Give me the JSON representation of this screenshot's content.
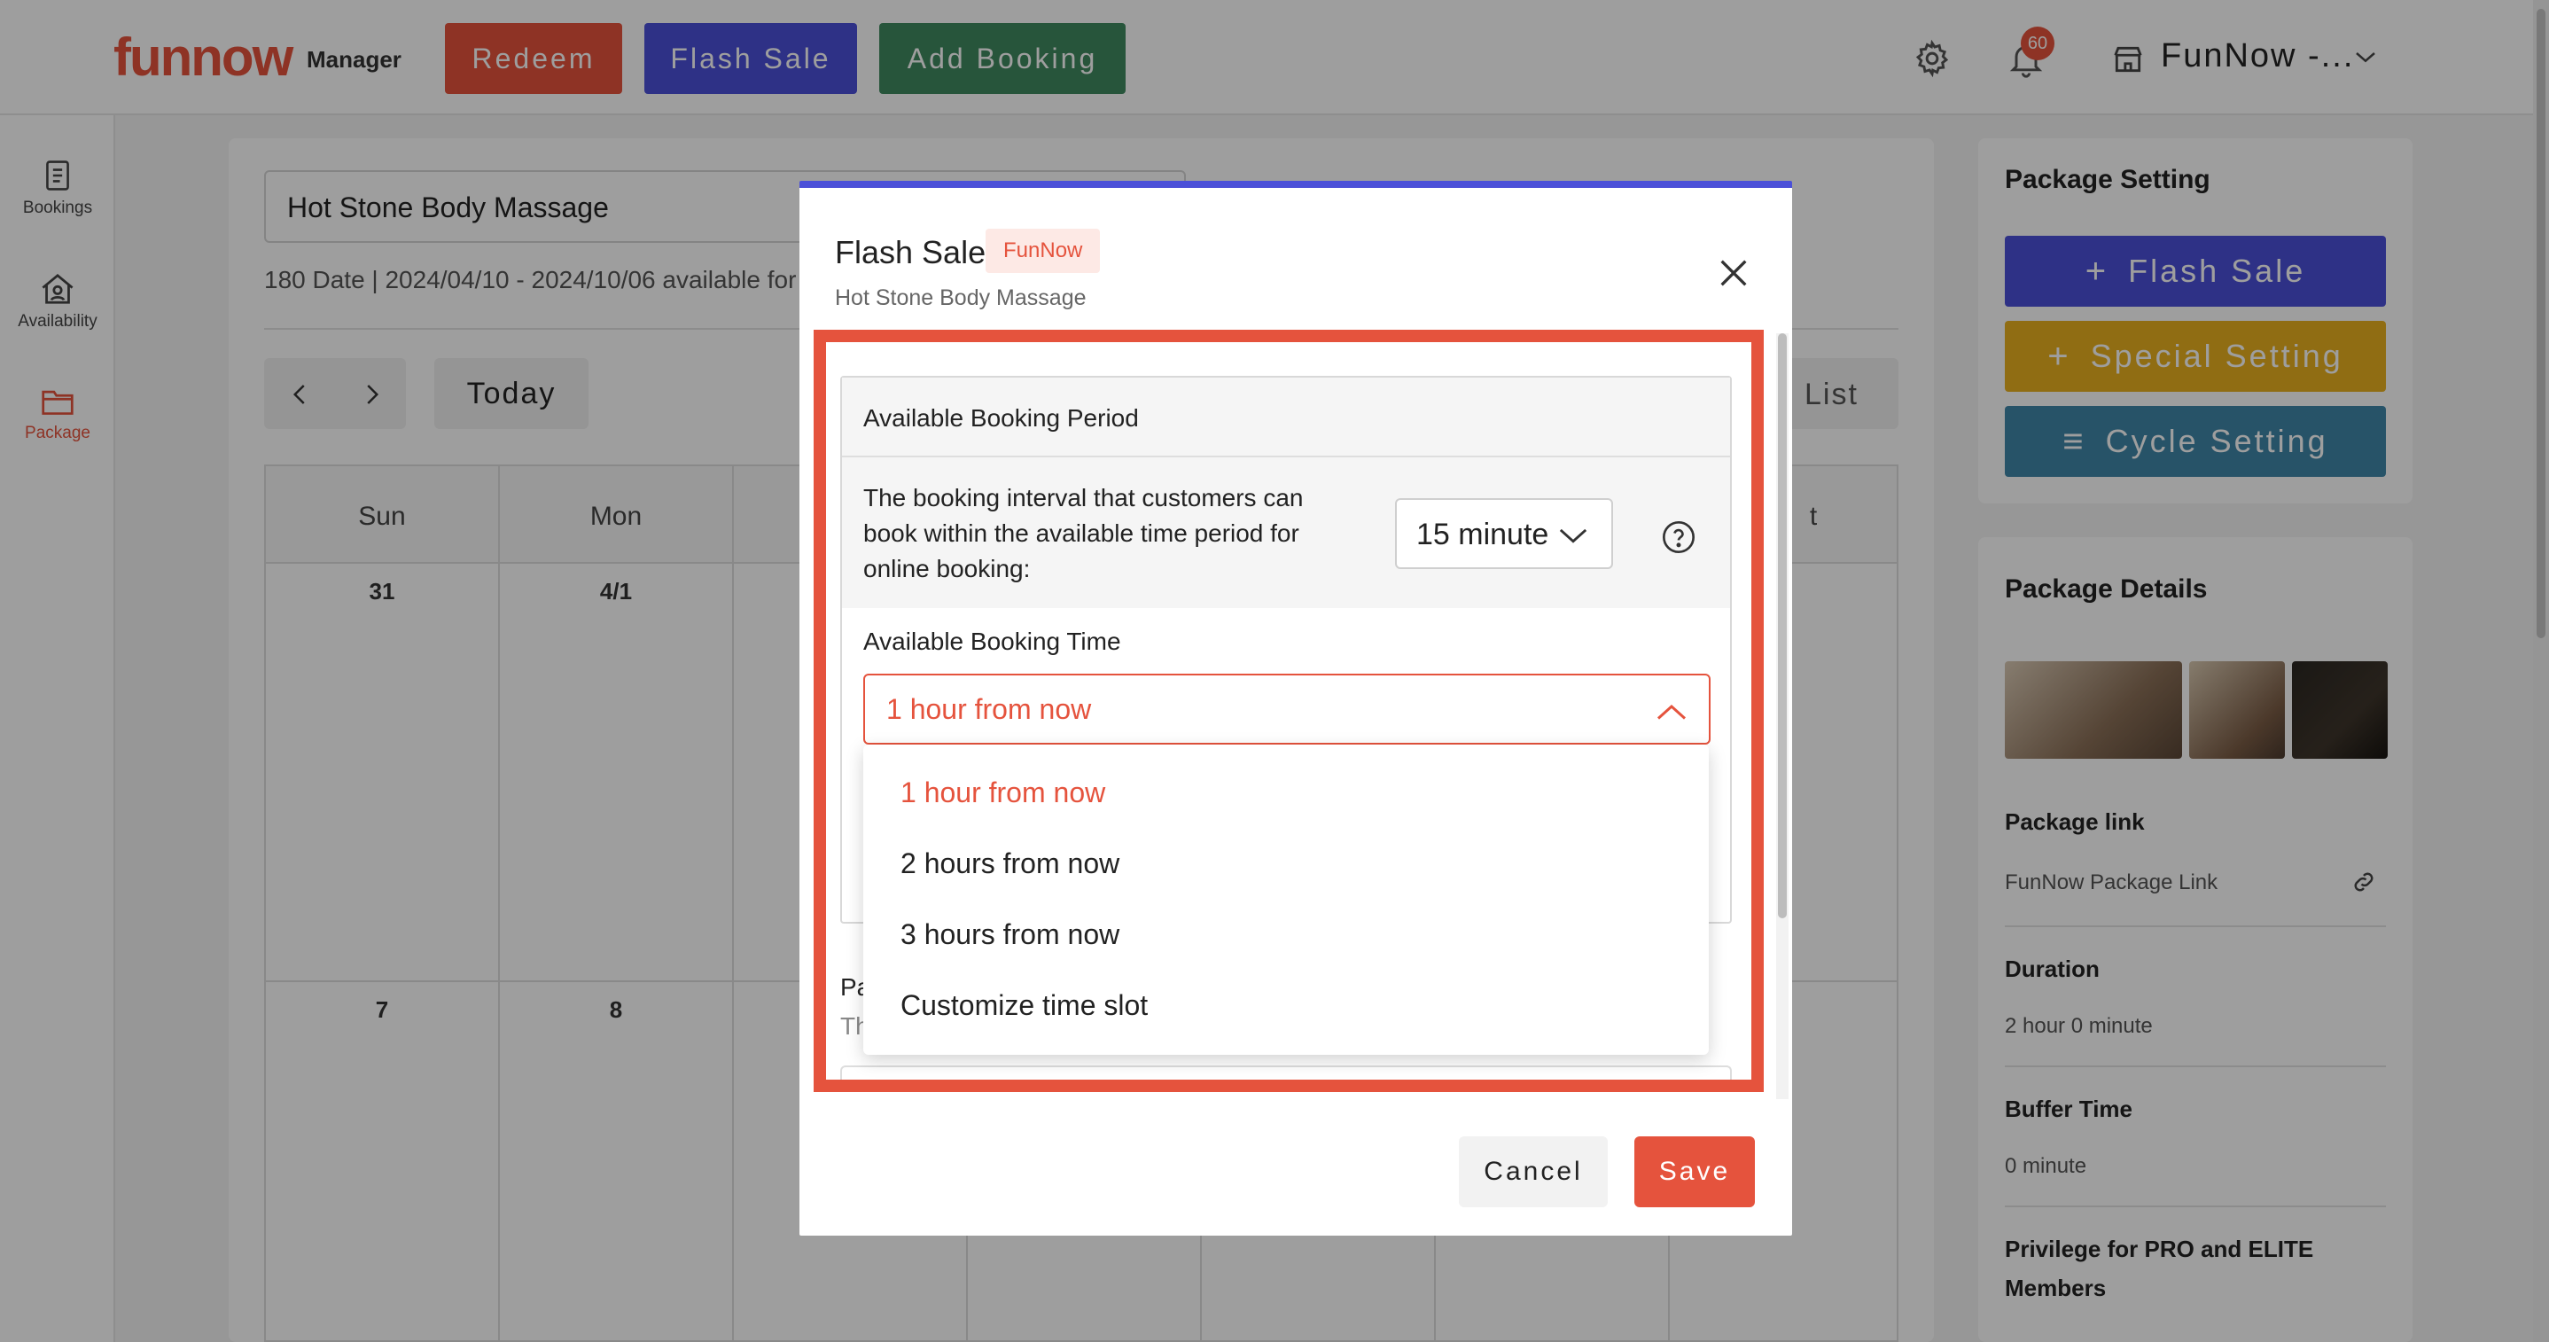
{
  "header": {
    "logo": "funnow",
    "logo_sub": "Manager",
    "redeem_label": "Redeem",
    "flash_sale_label": "Flash Sale",
    "add_booking_label": "Add Booking",
    "notification_count": "60",
    "store_name": "FunNow -...",
    "icons": [
      "gear-icon",
      "bell-icon",
      "store-icon",
      "chevron-down-icon"
    ]
  },
  "sidebar": {
    "items": [
      {
        "label": "Bookings",
        "icon": "document-icon"
      },
      {
        "label": "Availability",
        "icon": "home-user-icon"
      },
      {
        "label": "Package",
        "icon": "folder-icon"
      }
    ]
  },
  "main": {
    "package_select": "Hot Stone Body Massage",
    "available_text": "180 Date | 2024/04/10 - 2024/10/06 available for",
    "today_label": "Today",
    "list_label": "List",
    "calendar": {
      "days": [
        "Sun",
        "Mon",
        "",
        "",
        "",
        "",
        "t"
      ],
      "row1": [
        "31",
        "4/1"
      ],
      "row2": [
        "7",
        "8"
      ]
    }
  },
  "right": {
    "package_setting_title": "Package Setting",
    "flash_sale_label": "Flash Sale",
    "special_setting_label": "Special Setting",
    "cycle_setting_label": "Cycle Setting",
    "package_details_title": "Package Details",
    "package_link_label": "Package link",
    "package_link_value": "FunNow Package Link",
    "duration_label": "Duration",
    "duration_value": "2 hour 0 minute",
    "buffer_label": "Buffer Time",
    "buffer_value": "0 minute",
    "privilege_label_1": "Privilege for PRO and ELITE",
    "privilege_label_2": "Members"
  },
  "modal": {
    "title": "Flash Sale",
    "tag": "FunNow",
    "subtitle": "Hot Stone Body Massage",
    "section_title": "Available Booking Period",
    "interval_text_1": "The booking interval that customers can",
    "interval_text_2": "book within the available time period for",
    "interval_text_3": "online booking:",
    "interval_value": "15 minute",
    "available_time_label": "Available Booking Time",
    "available_time_value": "1 hour from now",
    "below_label": "Pa",
    "below_text": "Th",
    "options": [
      "1 hour from now",
      "2 hours from now",
      "3 hours from now",
      "Customize time slot"
    ],
    "cancel_label": "Cancel",
    "save_label": "Save"
  },
  "colors": {
    "accent": "#e5533d",
    "flash_purple": "#4b50d8",
    "add_green": "#3f8a60",
    "special_yellow": "#e8b120",
    "cycle_blue": "#3f86a8"
  }
}
